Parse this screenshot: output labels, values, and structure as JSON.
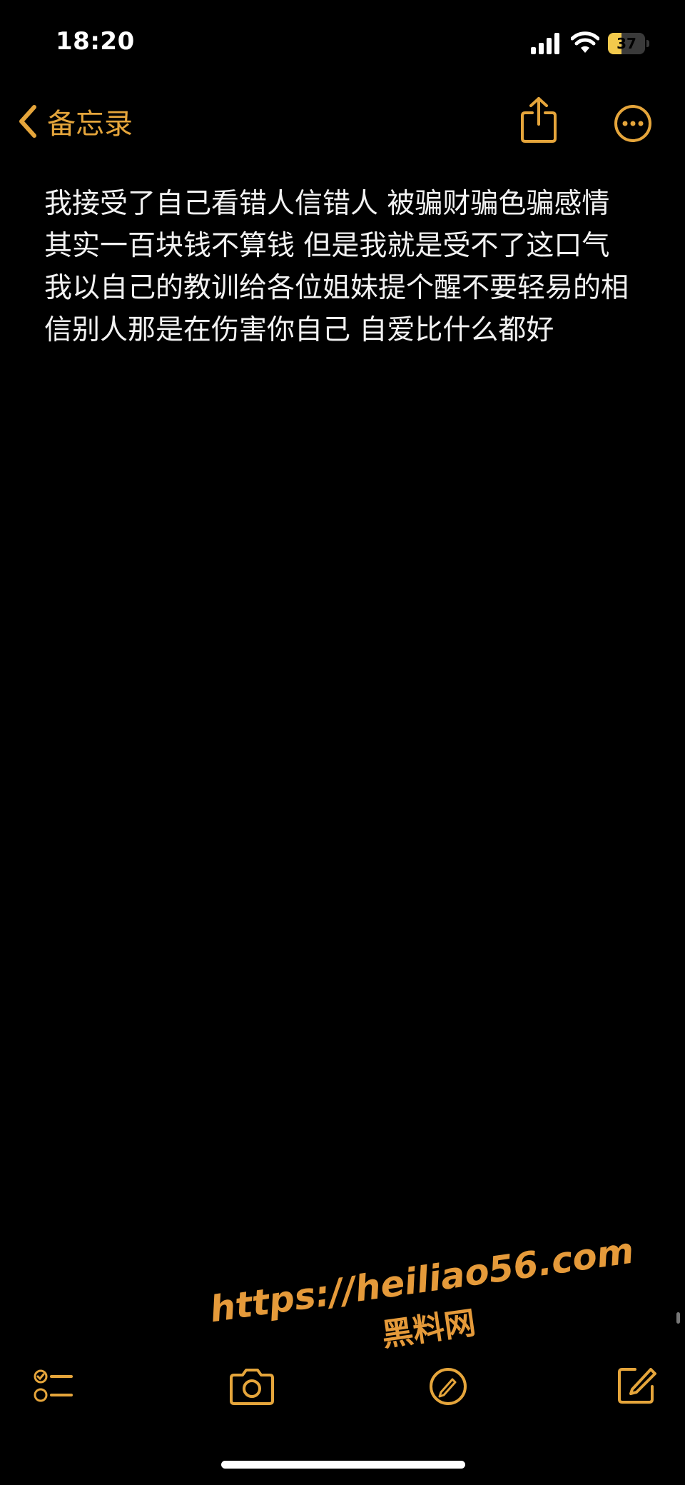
{
  "status_bar": {
    "time": "18:20",
    "battery_percent": "37",
    "battery_level": 0.37,
    "battery_charging": true
  },
  "nav": {
    "back_label": "备忘录"
  },
  "note": {
    "text": "我接受了自己看错人信错人 被骗财骗色骗感情 其实一百块钱不算钱 但是我就是受不了这口气 我以自己的教训给各位姐妹提个醒不要轻易的相信别人那是在伤害你自己 自爱比什么都好"
  },
  "watermark": {
    "url": "https://heiliao56.com",
    "name": "黑料网"
  },
  "icons": {
    "back": "chevron-left-icon",
    "share": "share-icon",
    "more": "ellipsis-circle-icon",
    "checklist": "checklist-icon",
    "camera": "camera-icon",
    "markup": "markup-icon",
    "compose": "compose-icon"
  },
  "colors": {
    "background": "#000000",
    "accent": "#e5a53b",
    "text": "#f2f2f2",
    "watermark": "#e59a3a"
  }
}
